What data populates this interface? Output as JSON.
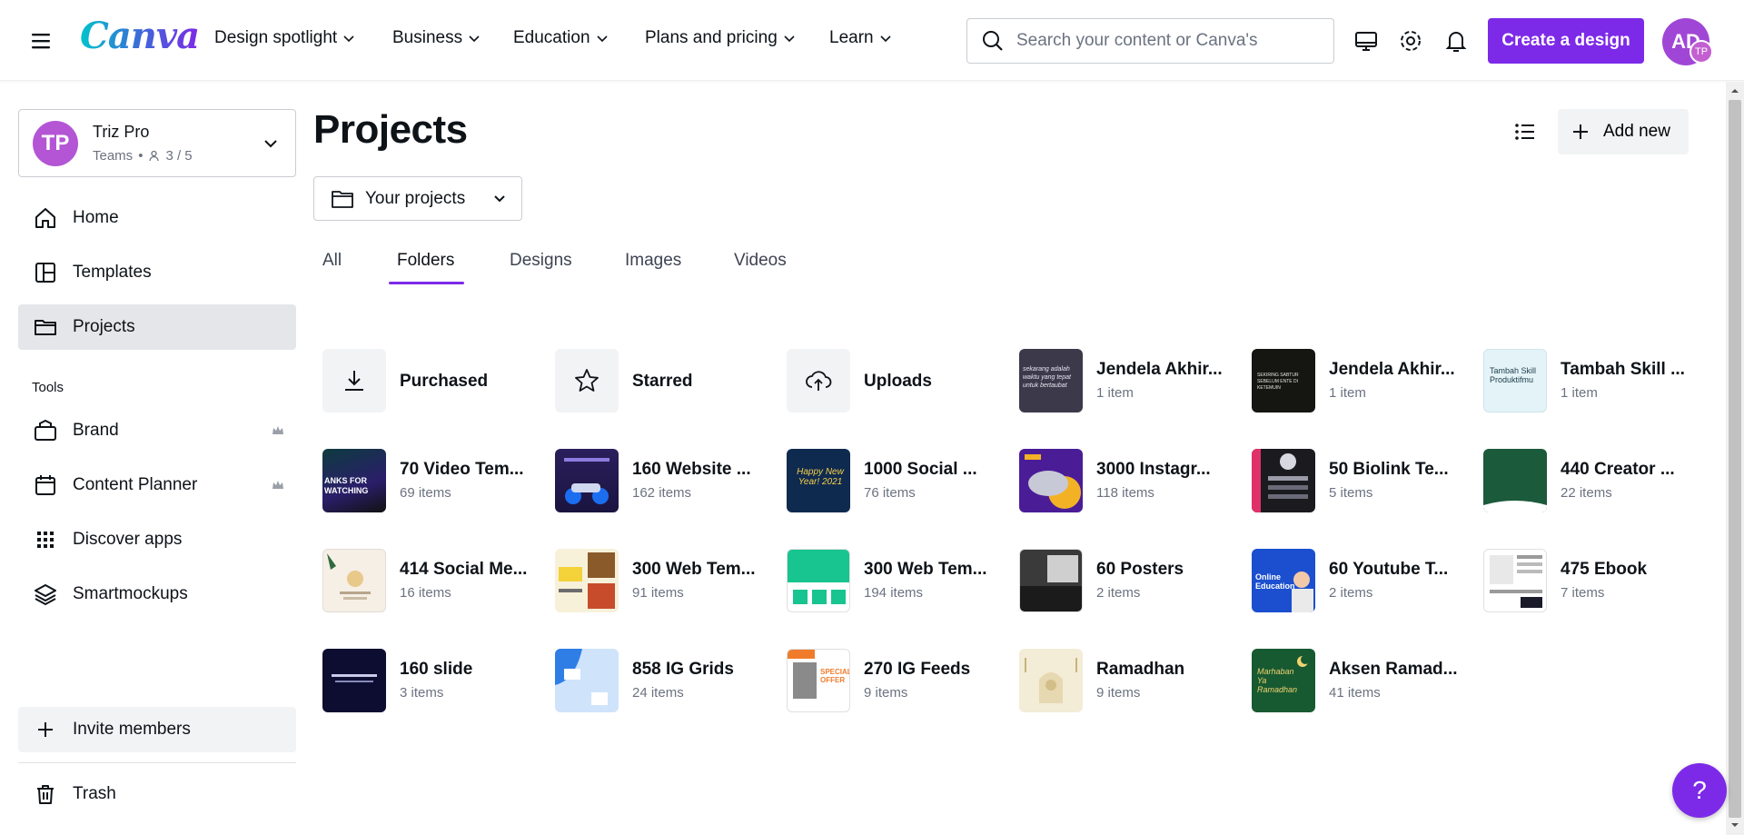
{
  "header": {
    "logo": "Canva",
    "nav": [
      {
        "label": "Design spotlight"
      },
      {
        "label": "Business"
      },
      {
        "label": "Education"
      },
      {
        "label": "Plans and pricing"
      },
      {
        "label": "Learn"
      }
    ],
    "search_placeholder": "Search your content or Canva's",
    "create_button": "Create a design",
    "avatar_initials": "AD",
    "avatar_badge": "TP"
  },
  "sidebar": {
    "team": {
      "initials": "TP",
      "name": "Triz Pro",
      "type": "Teams",
      "members": "3 / 5"
    },
    "items": [
      {
        "label": "Home"
      },
      {
        "label": "Templates"
      },
      {
        "label": "Projects"
      }
    ],
    "tools_label": "Tools",
    "tools": [
      {
        "label": "Brand",
        "premium": true
      },
      {
        "label": "Content Planner",
        "premium": true
      },
      {
        "label": "Discover apps",
        "premium": false
      },
      {
        "label": "Smartmockups",
        "premium": false
      }
    ],
    "invite": "Invite members",
    "trash": "Trash"
  },
  "main": {
    "title": "Projects",
    "add_new": "Add new",
    "project_filter": "Your projects",
    "tabs": [
      {
        "label": "All"
      },
      {
        "label": "Folders",
        "active": true
      },
      {
        "label": "Designs"
      },
      {
        "label": "Images"
      },
      {
        "label": "Videos"
      }
    ],
    "folders": [
      {
        "name": "Purchased",
        "count": ""
      },
      {
        "name": "Starred",
        "count": ""
      },
      {
        "name": "Uploads",
        "count": ""
      },
      {
        "name": "Jendela Akhir...",
        "count": "1 item"
      },
      {
        "name": "Jendela Akhir...",
        "count": "1 item"
      },
      {
        "name": "Tambah Skill ...",
        "count": "1 item"
      },
      {
        "name": "70 Video Tem...",
        "count": "69 items"
      },
      {
        "name": "160 Website ...",
        "count": "162 items"
      },
      {
        "name": "1000 Social ...",
        "count": "76 items"
      },
      {
        "name": "3000 Instagr...",
        "count": "118 items"
      },
      {
        "name": "50 Biolink Te...",
        "count": "5 items"
      },
      {
        "name": "440 Creator ...",
        "count": "22 items"
      },
      {
        "name": "414 Social Me...",
        "count": "16 items"
      },
      {
        "name": "300 Web Tem...",
        "count": "91 items"
      },
      {
        "name": "300 Web Tem...",
        "count": "194 items"
      },
      {
        "name": "60 Posters",
        "count": "2 items"
      },
      {
        "name": "60 Youtube T...",
        "count": "2 items"
      },
      {
        "name": "475 Ebook",
        "count": "7 items"
      },
      {
        "name": "160 slide",
        "count": "3 items"
      },
      {
        "name": "858 IG Grids",
        "count": "24 items"
      },
      {
        "name": "270 IG Feeds",
        "count": "9 items"
      },
      {
        "name": "Ramadhan",
        "count": "9 items"
      },
      {
        "name": "Aksen Ramad...",
        "count": "41 items"
      }
    ],
    "thumb_text": {
      "jendela1": "sekarang adalah waktu yang tepat untuk bertaubat",
      "jendela2": "SEKIRING SABTUR SEBELUM ENTE DI KETEMUIN",
      "tambah": "Tambah Skill Produktifmu",
      "video": "ANKS FOR WATCHING",
      "social1000": "Happy New Year! 2021",
      "youtube60": "Online Education",
      "aksen": "Marhaban Ya Ramadhan",
      "igfeeds": "SPECIAL OFFER"
    }
  },
  "help": "?"
}
